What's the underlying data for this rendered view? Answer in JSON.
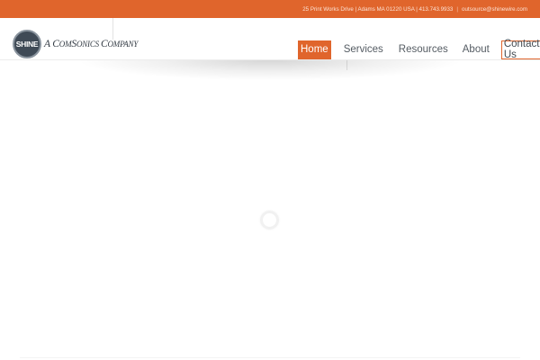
{
  "topbar": {
    "contact_info": "25 Print Works Drive | Adams MA 01220 USA | 413.743.9933",
    "separator": "|",
    "email": "outsource@shinewire.com"
  },
  "logo": {
    "badge_text": "SHINE",
    "tagline_prefix": "A ",
    "tagline_cap1": "C",
    "tagline_rest1": "OM",
    "tagline_cap2": "S",
    "tagline_rest2": "ONICS ",
    "tagline_cap3": "C",
    "tagline_rest3": "OMPANY"
  },
  "nav": {
    "items": [
      {
        "label": "Home"
      },
      {
        "label": "Services"
      },
      {
        "label": "Resources"
      },
      {
        "label": "About"
      },
      {
        "label": "Contact Us"
      }
    ]
  },
  "colors": {
    "brand_orange": "#e0652c",
    "logo_dark": "#3f4a56"
  }
}
